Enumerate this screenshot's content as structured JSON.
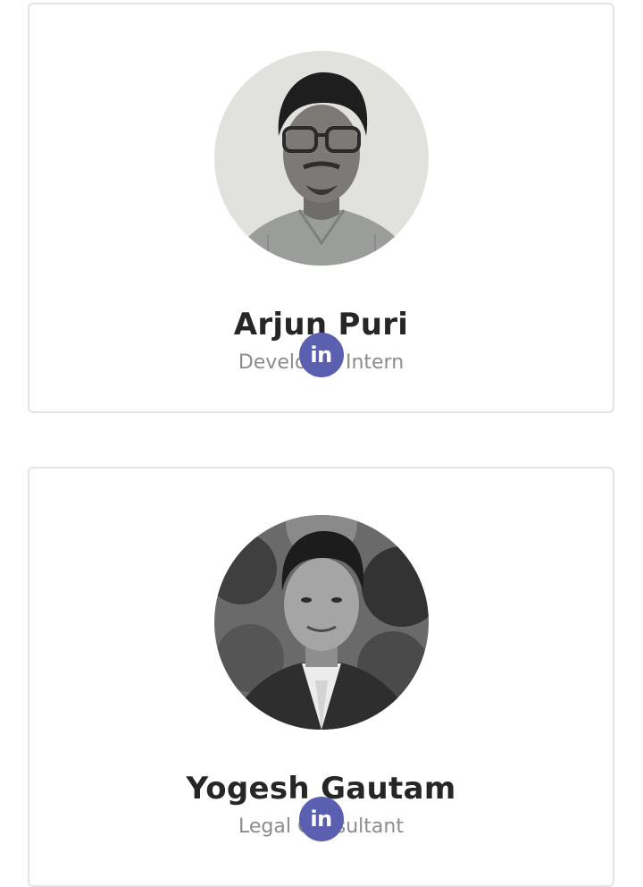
{
  "team": [
    {
      "name": "Arjun Puri",
      "role": "Developer Intern",
      "social_icon": "linkedin-icon",
      "social_label": "in"
    },
    {
      "name": "Yogesh Gautam",
      "role": "Legal Consultant",
      "social_icon": "linkedin-icon",
      "social_label": "in"
    }
  ],
  "colors": {
    "linkedin_accent": "#5a5fb0",
    "name_text": "#262626",
    "role_text": "#8c8c8c",
    "card_border": "#e3e3e3"
  }
}
